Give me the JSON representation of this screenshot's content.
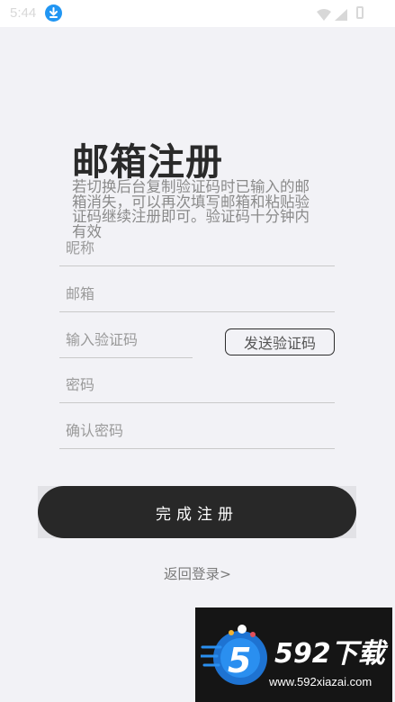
{
  "status_bar": {
    "time": "5:44",
    "icons": [
      "download-icon",
      "wifi-icon",
      "signal-icon",
      "battery-icon"
    ],
    "accent": "#2196f3"
  },
  "page": {
    "title": "邮箱注册",
    "hint": "若切换后台复制验证码时已输入的邮箱消失，可以再次填写邮箱和粘贴验证码继续注册即可。验证码十分钟内有效"
  },
  "form": {
    "nickname_placeholder": "昵称",
    "email_placeholder": "邮箱",
    "code_placeholder": "输入验证码",
    "send_code_label": "发送验证码",
    "password_placeholder": "密码",
    "confirm_password_placeholder": "确认密码",
    "submit_label": "完成注册",
    "back_label": "返回登录>"
  },
  "watermark": {
    "brand": "592下载",
    "url": "www.592xiazai.com"
  }
}
